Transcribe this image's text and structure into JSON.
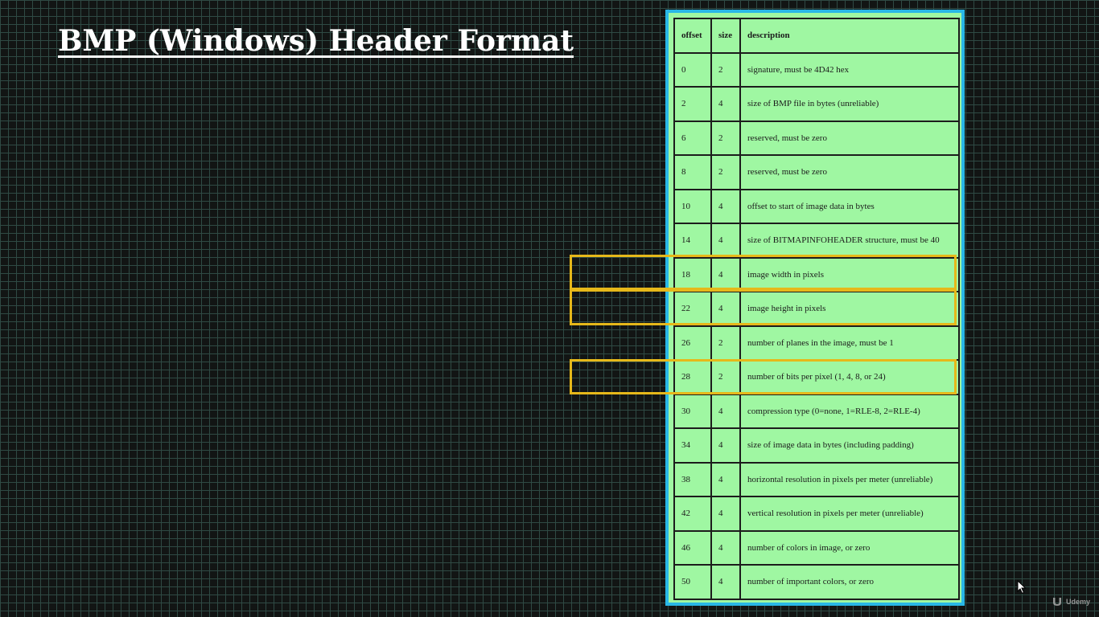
{
  "slide": {
    "title": "BMP (Windows) Header Format"
  },
  "table": {
    "headers": {
      "offset": "offset",
      "size": "size",
      "description": "description"
    },
    "rows": [
      {
        "offset": "0",
        "size": "2",
        "description": "signature, must be 4D42 hex"
      },
      {
        "offset": "2",
        "size": "4",
        "description": "size of BMP file in bytes (unreliable)"
      },
      {
        "offset": "6",
        "size": "2",
        "description": "reserved, must be zero"
      },
      {
        "offset": "8",
        "size": "2",
        "description": "reserved, must be zero"
      },
      {
        "offset": "10",
        "size": "4",
        "description": "offset to start of image data in bytes"
      },
      {
        "offset": "14",
        "size": "4",
        "description": "size of BITMAPINFOHEADER structure, must be 40"
      },
      {
        "offset": "18",
        "size": "4",
        "description": "image width in pixels",
        "highlighted": true
      },
      {
        "offset": "22",
        "size": "4",
        "description": "image height in pixels",
        "highlighted": true
      },
      {
        "offset": "26",
        "size": "2",
        "description": "number of planes in the image, must be 1"
      },
      {
        "offset": "28",
        "size": "2",
        "description": "number of bits per pixel (1, 4, 8, or 24)",
        "highlighted": true
      },
      {
        "offset": "30",
        "size": "4",
        "description": "compression type (0=none, 1=RLE-8, 2=RLE-4)"
      },
      {
        "offset": "34",
        "size": "4",
        "description": "size of image data in bytes (including padding)"
      },
      {
        "offset": "38",
        "size": "4",
        "description": "horizontal resolution in pixels per meter (unreliable)"
      },
      {
        "offset": "42",
        "size": "4",
        "description": "vertical resolution in pixels per meter (unreliable)"
      },
      {
        "offset": "46",
        "size": "4",
        "description": "number of colors in image, or zero"
      },
      {
        "offset": "50",
        "size": "4",
        "description": "number of important colors, or zero"
      }
    ]
  },
  "colors": {
    "background": "#121514",
    "grid": "#2f4a44",
    "table_fill": "#9ff7a2",
    "frame": "#29b7e6",
    "highlight": "#e6b81a"
  },
  "watermark": {
    "text": "Udemy",
    "icon": "udemy-logo-icon"
  },
  "cursor": {
    "icon": "mouse-pointer-icon"
  }
}
